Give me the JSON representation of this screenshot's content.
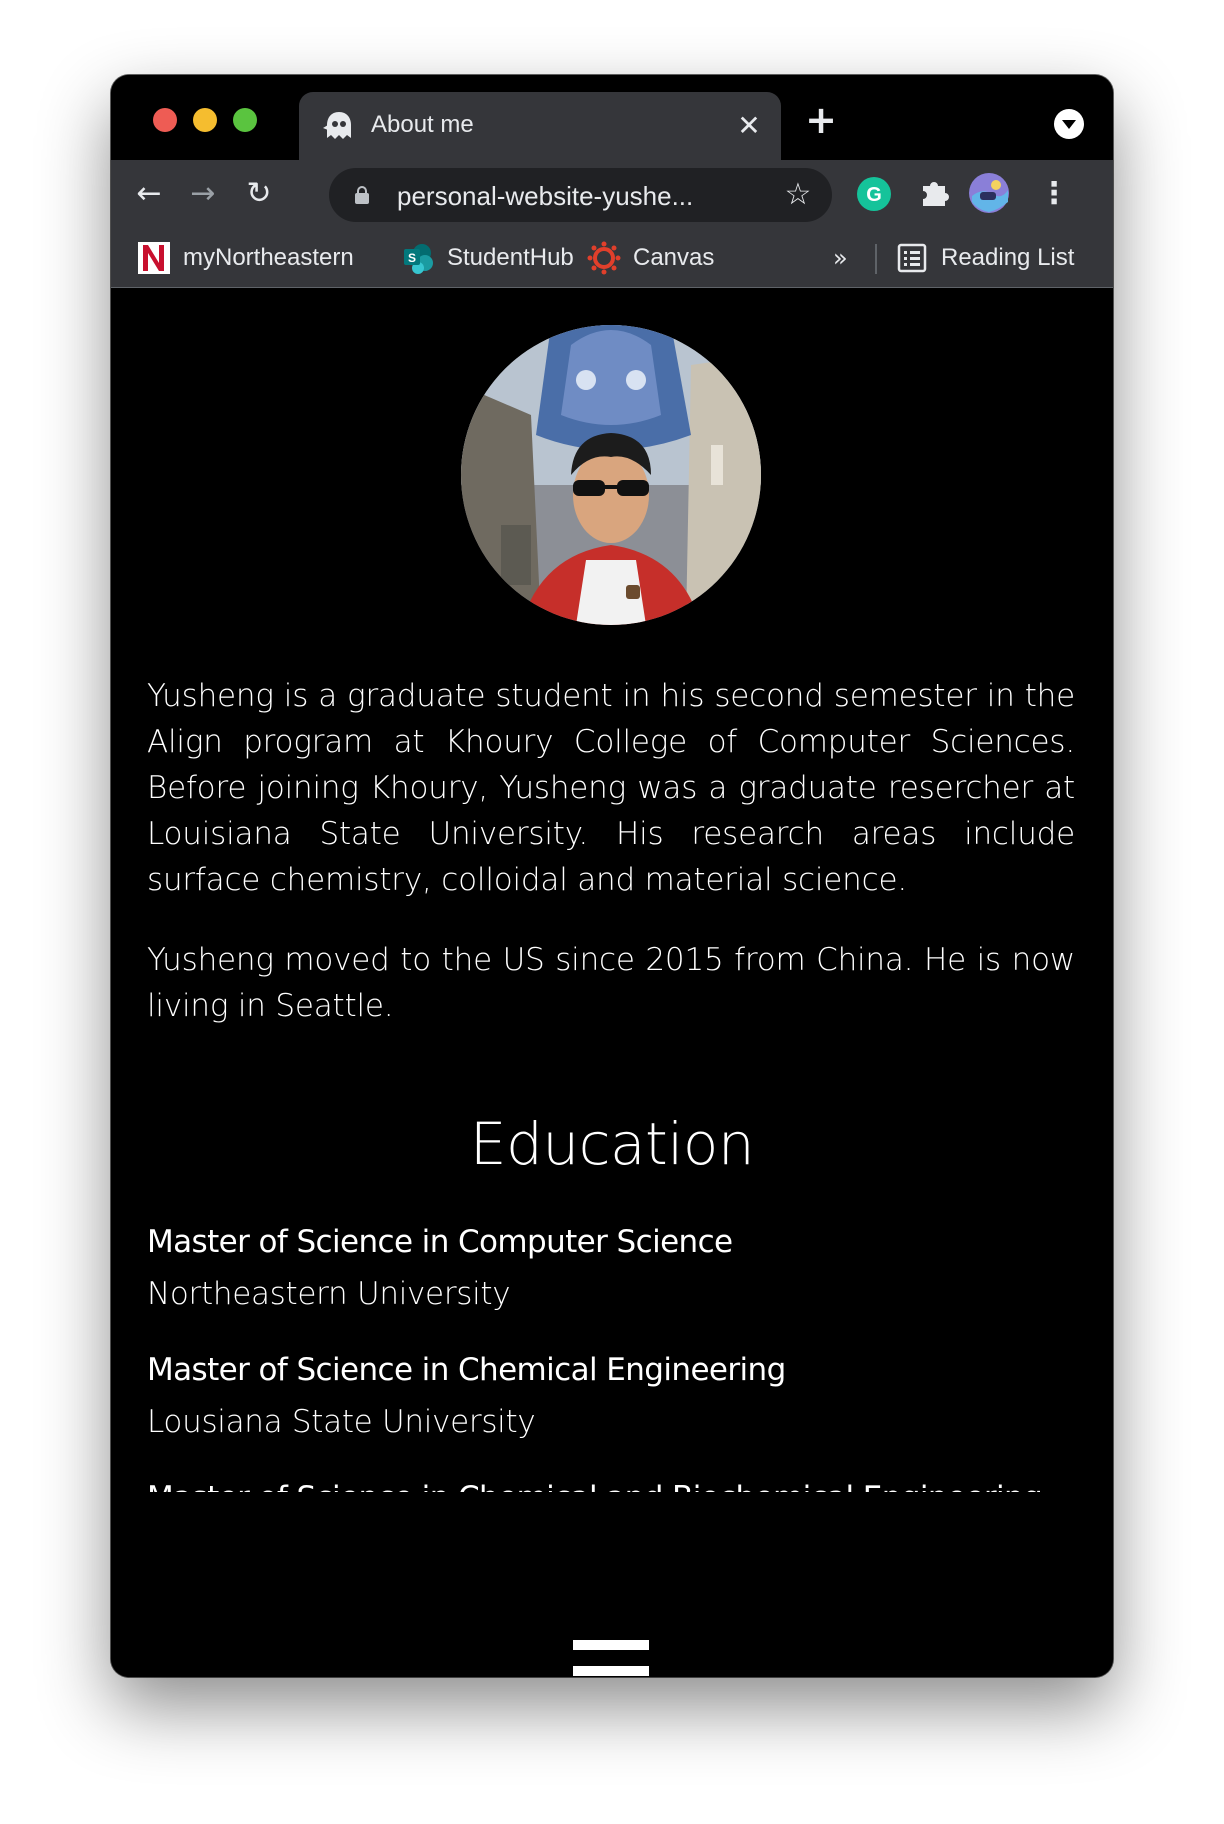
{
  "browser": {
    "tab": {
      "title": "About me",
      "close": "✕"
    },
    "new_tab": "+",
    "toolbar": {
      "back": "←",
      "forward": "→",
      "reload": "↻",
      "url": "personal-website-yushe...",
      "bookmark_star": "☆",
      "menu": "⋮"
    },
    "bookmarks": [
      {
        "label": "myNortheastern",
        "icon": "northeastern-n-icon"
      },
      {
        "label": "StudentHub",
        "icon": "sharepoint-icon"
      },
      {
        "label": "Canvas",
        "icon": "canvas-icon"
      }
    ],
    "more_bookmarks": "»",
    "reading_list": {
      "label": "Reading List",
      "icon": "reading-list-icon"
    }
  },
  "page": {
    "bio": [
      "Yusheng is a graduate student in his second semester in the Align program at Khoury College of Computer Sciences. Before joining Khoury, Yusheng was a graduate resercher at Louisiana State University. His research areas include surface chemistry, colloidal and material science.",
      "Yusheng moved to the US since 2015 from China. He is now living in Seattle."
    ],
    "education": {
      "heading": "Education",
      "items": [
        {
          "degree": "Master of Science in Computer Science",
          "school": "Northeastern University"
        },
        {
          "degree": "Master of Science in Chemical Engineering",
          "school": "Lousiana State University"
        },
        {
          "degree": "Master of Science in Chemical and Biochemical Engineering",
          "school": ""
        }
      ]
    }
  },
  "colors": {
    "chrome_dark": "#35363a",
    "omnibox": "#202124",
    "page_bg": "#000000",
    "text": "#ffffff"
  }
}
